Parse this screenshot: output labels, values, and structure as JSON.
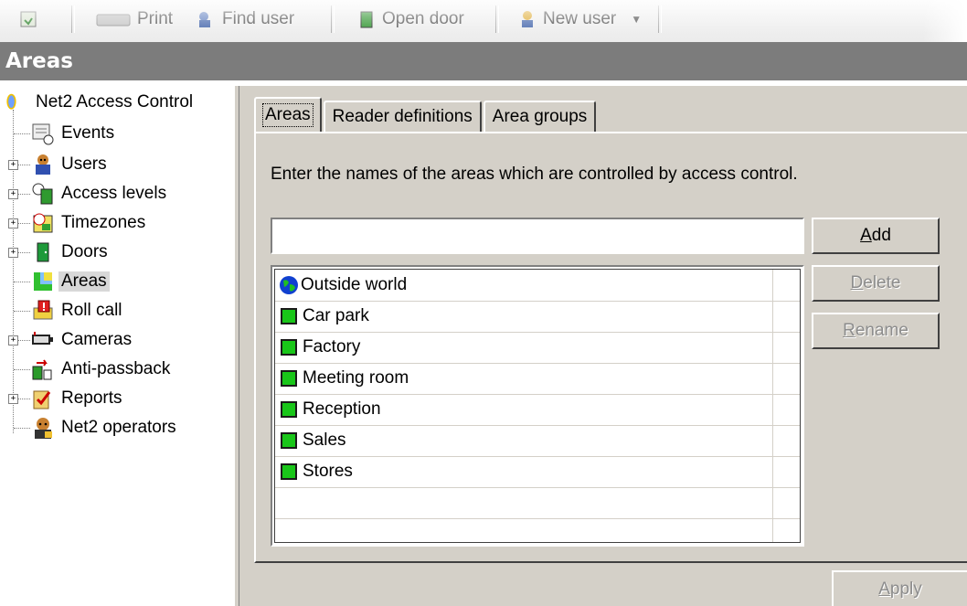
{
  "toolbar": {
    "print_label": "Print",
    "find_user_label": "Find user",
    "open_door_label": "Open door",
    "new_user_label": "New user"
  },
  "title": "Areas",
  "tree": {
    "root": "Net2 Access Control",
    "items": [
      {
        "label": "Events",
        "icon": "events-icon",
        "expandable": false
      },
      {
        "label": "Users",
        "icon": "users-icon",
        "expandable": true
      },
      {
        "label": "Access levels",
        "icon": "access-levels-icon",
        "expandable": true
      },
      {
        "label": "Timezones",
        "icon": "timezones-icon",
        "expandable": true
      },
      {
        "label": "Doors",
        "icon": "door-icon",
        "expandable": true
      },
      {
        "label": "Areas",
        "icon": "areas-icon",
        "expandable": false,
        "selected": true
      },
      {
        "label": "Roll call",
        "icon": "roll-call-icon",
        "expandable": false
      },
      {
        "label": "Cameras",
        "icon": "camera-icon",
        "expandable": true
      },
      {
        "label": "Anti-passback",
        "icon": "anti-passback-icon",
        "expandable": false
      },
      {
        "label": "Reports",
        "icon": "reports-icon",
        "expandable": true
      },
      {
        "label": "Net2 operators",
        "icon": "operators-icon",
        "expandable": false
      }
    ]
  },
  "tabs": [
    "Areas",
    "Reader definitions",
    "Area groups"
  ],
  "instruction": "Enter the names of the areas which are controlled by access control.",
  "input": {
    "value": "",
    "placeholder": ""
  },
  "buttons": {
    "add": {
      "pre": "",
      "key": "A",
      "post": "dd"
    },
    "delete": {
      "pre": "",
      "key": "D",
      "post": "elete"
    },
    "rename": {
      "pre": "",
      "key": "R",
      "post": "ename"
    },
    "apply": {
      "pre": "",
      "key": "A",
      "post": "pply"
    }
  },
  "areas": [
    "Outside world",
    "Car park",
    "Factory",
    "Meeting room",
    "Reception",
    "Sales",
    "Stores"
  ],
  "colors": {
    "title_bar": "#7c7c7c",
    "panel": "#d4d0c8",
    "area_green": "#19c619"
  }
}
